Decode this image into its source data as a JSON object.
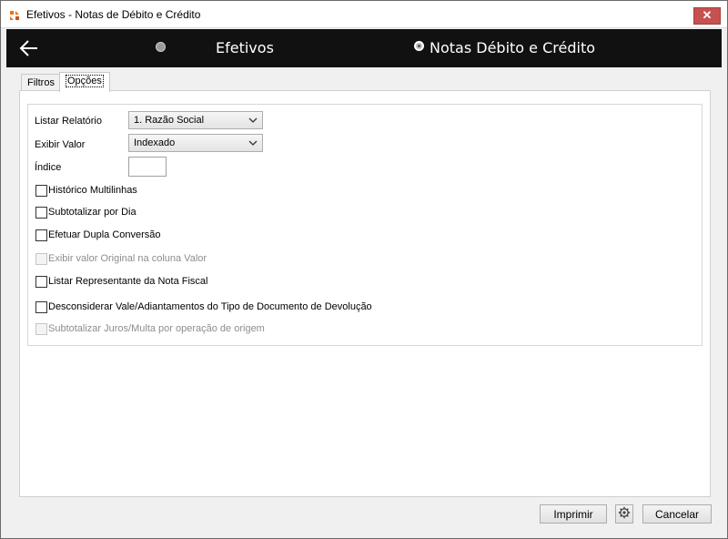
{
  "window": {
    "title": "Efetivos - Notas de Débito e Crédito",
    "close_label": "✕"
  },
  "stepbar": {
    "steps": [
      {
        "label": "Efetivos",
        "active": false
      },
      {
        "label": "Notas Débito e Crédito",
        "active": true
      }
    ]
  },
  "tabs": [
    {
      "label": "Filtros",
      "active": false
    },
    {
      "label": "Opções",
      "active": true
    }
  ],
  "options": {
    "listar_relatorio": {
      "label": "Listar Relatório",
      "value": "1. Razão Social"
    },
    "exibir_valor": {
      "label": "Exibir Valor",
      "value": "Indexado"
    },
    "indice": {
      "label": "Índice",
      "value": ""
    },
    "checkboxes": [
      {
        "label": "Histórico Multilinhas",
        "checked": false,
        "enabled": true
      },
      {
        "label": "Subtotalizar por Dia",
        "checked": false,
        "enabled": true
      },
      {
        "label": "Efetuar Dupla Conversão",
        "checked": false,
        "enabled": true
      },
      {
        "label": "Exibir valor Original na coluna Valor",
        "checked": false,
        "enabled": false
      },
      {
        "label": "Listar Representante da Nota Fiscal",
        "checked": false,
        "enabled": true
      },
      {
        "label": "Desconsiderar Vale/Adiantamentos do Tipo de Documento de Devolução",
        "checked": false,
        "enabled": true
      },
      {
        "label": "Subtotalizar Juros/Multa por operação de origem",
        "checked": false,
        "enabled": false
      }
    ]
  },
  "footer": {
    "print_label": "Imprimir",
    "cancel_label": "Cancelar",
    "settings_icon": "gear-icon"
  },
  "colors": {
    "stepbar_bg": "#111111",
    "close_bg": "#c75050"
  }
}
